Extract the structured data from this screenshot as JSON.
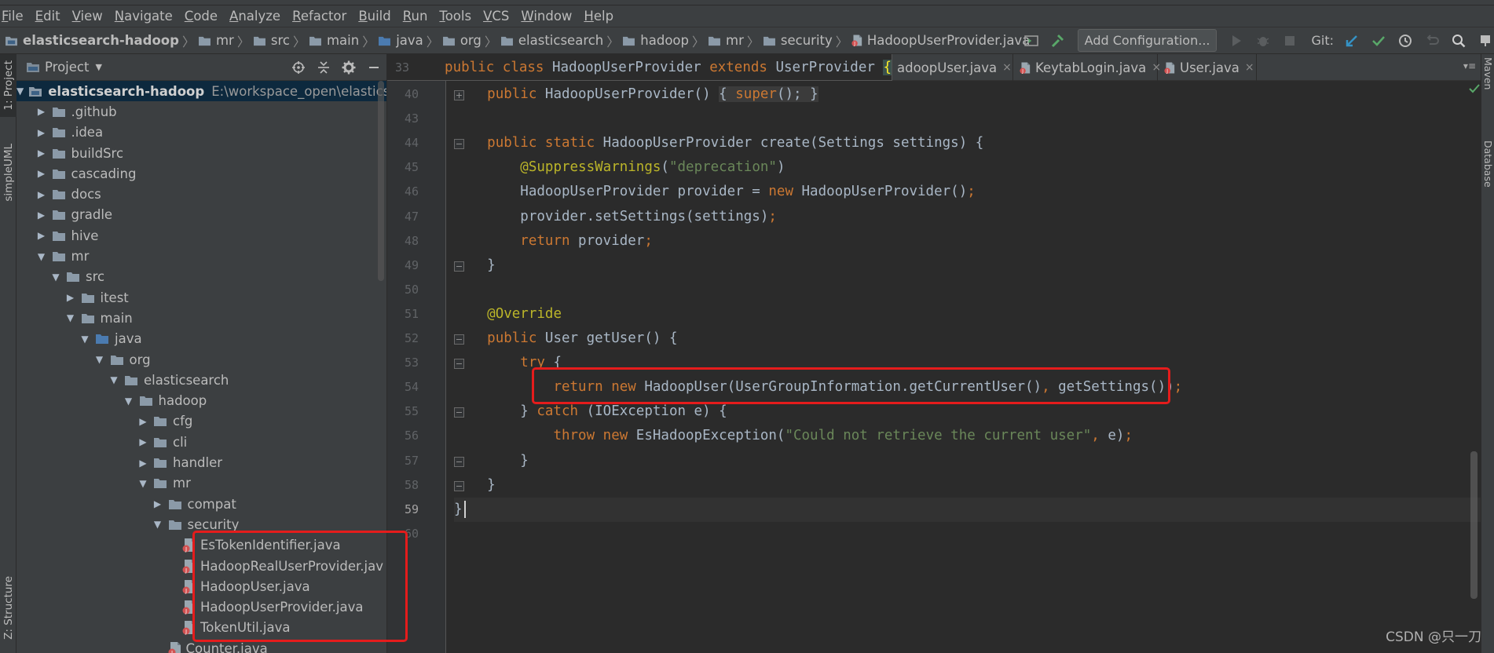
{
  "menu": [
    "File",
    "Edit",
    "View",
    "Navigate",
    "Code",
    "Analyze",
    "Refactor",
    "Build",
    "Run",
    "Tools",
    "VCS",
    "Window",
    "Help"
  ],
  "menu_mnemonics": [
    "F",
    "E",
    "V",
    "N",
    "C",
    "A",
    "R",
    "B",
    "R",
    "T",
    "V",
    "W",
    "H"
  ],
  "breadcrumbs": [
    "elasticsearch-hadoop",
    "mr",
    "src",
    "main",
    "java",
    "org",
    "elasticsearch",
    "hadoop",
    "mr",
    "security",
    "HadoopUserProvider.java"
  ],
  "toolbar": {
    "add_configuration": "Add Configuration...",
    "git_label": "Git:"
  },
  "left_tabs": {
    "project": "1: Project",
    "simpleuml": "simpleUML",
    "structure": "Z: Structure"
  },
  "right_tabs": {
    "maven": "Maven",
    "database": "Database"
  },
  "project_panel": {
    "title": "Project"
  },
  "tree": [
    {
      "label": "elasticsearch-hadoop",
      "path": "E:\\workspace_open\\elasticsearch-ha",
      "depth": 0,
      "state": "open",
      "kind": "module"
    },
    {
      "label": ".github",
      "depth": 1,
      "state": "closed",
      "kind": "folder"
    },
    {
      "label": ".idea",
      "depth": 1,
      "state": "closed",
      "kind": "folder"
    },
    {
      "label": "buildSrc",
      "depth": 1,
      "state": "closed",
      "kind": "folder"
    },
    {
      "label": "cascading",
      "depth": 1,
      "state": "closed",
      "kind": "folder"
    },
    {
      "label": "docs",
      "depth": 1,
      "state": "closed",
      "kind": "folder"
    },
    {
      "label": "gradle",
      "depth": 1,
      "state": "closed",
      "kind": "folder"
    },
    {
      "label": "hive",
      "depth": 1,
      "state": "closed",
      "kind": "folder"
    },
    {
      "label": "mr",
      "depth": 1,
      "state": "open",
      "kind": "folder"
    },
    {
      "label": "src",
      "depth": 2,
      "state": "open",
      "kind": "folder"
    },
    {
      "label": "itest",
      "depth": 3,
      "state": "closed",
      "kind": "folder"
    },
    {
      "label": "main",
      "depth": 3,
      "state": "open",
      "kind": "folder"
    },
    {
      "label": "java",
      "depth": 4,
      "state": "open",
      "kind": "folder-src"
    },
    {
      "label": "org",
      "depth": 5,
      "state": "open",
      "kind": "folder"
    },
    {
      "label": "elasticsearch",
      "depth": 6,
      "state": "open",
      "kind": "folder"
    },
    {
      "label": "hadoop",
      "depth": 7,
      "state": "open",
      "kind": "folder"
    },
    {
      "label": "cfg",
      "depth": 8,
      "state": "closed",
      "kind": "folder"
    },
    {
      "label": "cli",
      "depth": 8,
      "state": "closed",
      "kind": "folder"
    },
    {
      "label": "handler",
      "depth": 8,
      "state": "closed",
      "kind": "folder"
    },
    {
      "label": "mr",
      "depth": 8,
      "state": "open",
      "kind": "folder"
    },
    {
      "label": "compat",
      "depth": 9,
      "state": "closed",
      "kind": "folder"
    },
    {
      "label": "security",
      "depth": 9,
      "state": "open",
      "kind": "folder"
    },
    {
      "label": "EsTokenIdentifier.java",
      "depth": 10,
      "state": "none",
      "kind": "java"
    },
    {
      "label": "HadoopRealUserProvider.jav",
      "depth": 10,
      "state": "none",
      "kind": "java"
    },
    {
      "label": "HadoopUser.java",
      "depth": 10,
      "state": "none",
      "kind": "java"
    },
    {
      "label": "HadoopUserProvider.java",
      "depth": 10,
      "state": "none",
      "kind": "java"
    },
    {
      "label": "TokenUtil.java",
      "depth": 10,
      "state": "none",
      "kind": "java"
    },
    {
      "label": "Counter.java",
      "depth": 9,
      "state": "none",
      "kind": "java"
    }
  ],
  "editor_tabs": [
    {
      "label": "adoopUser.java",
      "close": "×"
    },
    {
      "label": "KeytabLogin.java",
      "close": "×"
    },
    {
      "label": "User.java",
      "close": "×"
    }
  ],
  "sticky_header": {
    "line": "33",
    "text_kw1": "public class ",
    "text_name": "HadoopUserProvider ",
    "text_kw2": "extends ",
    "text_parent": "UserProvider ",
    "text_brace": "{"
  },
  "code_lines": [
    {
      "n": "40",
      "html": "    <span class=\"kw\">public</span> HadoopUserProvider() <span class=\"fold-text\">{ <span class=\"kw\">super</span>(); }</span>"
    },
    {
      "n": "43",
      "html": ""
    },
    {
      "n": "44",
      "html": "    <span class=\"kw\">public static</span> HadoopUserProvider create(Settings settings) {"
    },
    {
      "n": "45",
      "html": "        <span class=\"ann\">@SuppressWarnings</span>(<span class=\"str\">\"deprecation\"</span>)"
    },
    {
      "n": "46",
      "html": "        HadoopUserProvider provider = <span class=\"kw\">new</span> HadoopUserProvider()<span class=\"kw\">;</span>"
    },
    {
      "n": "47",
      "html": "        provider.setSettings(settings)<span class=\"kw\">;</span>"
    },
    {
      "n": "48",
      "html": "        <span class=\"kw\">return</span> provider<span class=\"kw\">;</span>"
    },
    {
      "n": "49",
      "html": "    }"
    },
    {
      "n": "50",
      "html": ""
    },
    {
      "n": "51",
      "html": "    <span class=\"ann\">@Override</span>"
    },
    {
      "n": "52",
      "html": "    <span class=\"kw\">public</span> User getUser() {"
    },
    {
      "n": "53",
      "html": "        <span class=\"kw\">try</span> {"
    },
    {
      "n": "54",
      "html": "            <span class=\"kw\">return new</span> HadoopUser(UserGroupInformation.getCurrentUser()<span class=\"kw\">,</span> getSettings())<span class=\"kw\">;</span>"
    },
    {
      "n": "55",
      "html": "        } <span class=\"kw\">catch</span> (IOException e) {"
    },
    {
      "n": "56",
      "html": "            <span class=\"kw\">throw new</span> EsHadoopException(<span class=\"str\">\"Could not retrieve the current user\"</span><span class=\"kw\">,</span> e)<span class=\"kw\">;</span>"
    },
    {
      "n": "57",
      "html": "        }"
    },
    {
      "n": "58",
      "html": "    }"
    },
    {
      "n": "59",
      "html": "}"
    },
    {
      "n": "60",
      "html": ""
    }
  ],
  "watermark": "CSDN @只一刀",
  "colors": {
    "keyword": "#cc7832",
    "string": "#6a8759",
    "annotation": "#bbb529",
    "highlight_box": "#e51c1c",
    "selection": "#0d293e"
  }
}
